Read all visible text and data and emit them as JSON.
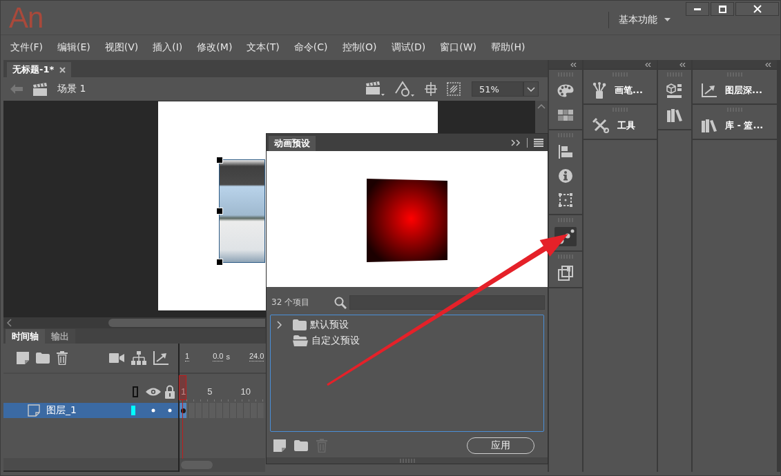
{
  "title_bar": {
    "logo": "An",
    "workspace": "基本功能",
    "window_buttons": [
      {
        "kind": "minimize"
      },
      {
        "kind": "maximize"
      },
      {
        "kind": "close"
      }
    ]
  },
  "menu_bar": [
    "文件(F)",
    "编辑(E)",
    "视图(V)",
    "插入(I)",
    "修改(M)",
    "文本(T)",
    "命令(C)",
    "控制(O)",
    "调试(D)",
    "窗口(W)",
    "帮助(H)"
  ],
  "document_tabs": [
    {
      "label": "无标题-1*",
      "selected": true
    }
  ],
  "edit_bar": {
    "scene": "场景 1",
    "zoom": "51%"
  },
  "timeline": {
    "tabs": [
      {
        "label": "时间轴",
        "selected": true
      },
      {
        "label": "输出",
        "selected": false
      }
    ],
    "current_frame": "1",
    "time": "0.0",
    "time_unit": "s",
    "frame_rate": "24.0",
    "ruler": [
      "1",
      "5",
      "10"
    ],
    "layers": [
      {
        "name": "图层_1",
        "selected": true,
        "color": "#00ffff"
      }
    ]
  },
  "motion_presets_panel": {
    "title": "动画预设",
    "item_count": "32 个项目",
    "tree": [
      {
        "label": "默认预设",
        "kind": "collapsed-folder",
        "selected": false
      },
      {
        "label": "自定义预设",
        "kind": "empty-folder",
        "selected": false
      }
    ],
    "footer_tools": [
      {
        "kind": "new-preset",
        "disabled": false
      },
      {
        "kind": "new-folder",
        "disabled": false
      },
      {
        "kind": "delete",
        "disabled": true
      }
    ],
    "apply_button": "应用"
  },
  "dock": {
    "columns": [
      {
        "kind": "icons",
        "groups": [
          [
            {
              "kind": "palette",
              "selected": false
            },
            {
              "kind": "swatches",
              "selected": false
            }
          ],
          [
            {
              "kind": "align",
              "selected": false
            },
            {
              "kind": "info",
              "selected": false
            },
            {
              "kind": "transform",
              "selected": false
            }
          ],
          [
            {
              "kind": "dots",
              "selected": true
            }
          ],
          [
            {
              "kind": "stack",
              "selected": false
            }
          ]
        ]
      },
      {
        "kind": "panels",
        "panels": [
          {
            "kind": "brush",
            "label": "画笔..."
          },
          {
            "kind": "tools",
            "label": "工具"
          }
        ]
      },
      {
        "kind": "icons",
        "groups": [
          [
            {
              "kind": "cube",
              "selected": false
            },
            {
              "kind": "books",
              "selected": false
            }
          ]
        ]
      },
      {
        "kind": "panels",
        "panels": [
          {
            "kind": "graph",
            "label": "图层深..."
          },
          {
            "kind": "books",
            "label": "库 - 篮..."
          }
        ]
      }
    ]
  }
}
